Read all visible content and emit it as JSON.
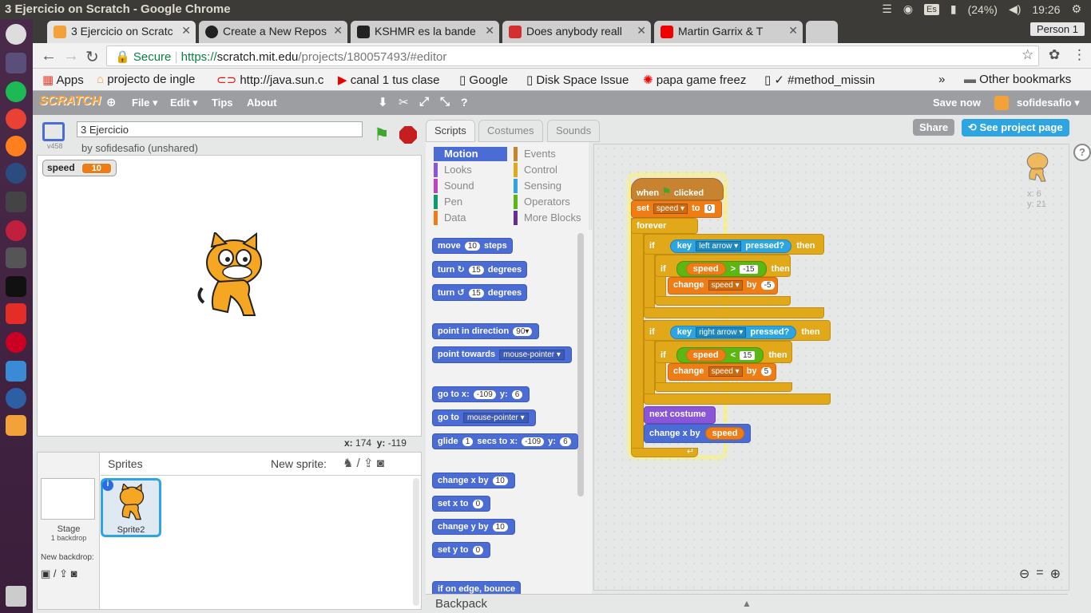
{
  "window_title": "3 Ejercicio on Scratch - Google Chrome",
  "system": {
    "lang": "Es",
    "battery": "(24%)",
    "time": "19:26"
  },
  "tabs": [
    {
      "label": "3 Ejercicio on Scratc",
      "icon_color": "#f3a23a"
    },
    {
      "label": "Create a New Repos",
      "icon_color": "#222"
    },
    {
      "label": "KSHMR es la bande",
      "icon_color": "#222"
    },
    {
      "label": "Does anybody reall",
      "icon_color": "#d32f2f"
    },
    {
      "label": "Martin Garrix & T",
      "icon_color": "#e00"
    }
  ],
  "person": "Person 1",
  "url": {
    "secure": "Secure",
    "scheme": "https://",
    "host": "scratch.mit.edu",
    "path": "/projects/180057493/#editor"
  },
  "bookmarks": [
    "Apps",
    "projecto de ingle",
    "http://java.sun.c",
    "canal 1 tus clase",
    "Google",
    "Disk Space Issue",
    "papa game freez",
    "#method_missin"
  ],
  "other_bookmarks": "Other bookmarks",
  "scratch_menu": {
    "file": "File",
    "edit": "Edit",
    "tips": "Tips",
    "about": "About",
    "save": "Save now",
    "user": "sofidesafio",
    "logo": "SCRATCH"
  },
  "project": {
    "title": "3 Ejercicio",
    "byline": "by sofidesafio (unshared)",
    "version": "v458"
  },
  "monitor": {
    "label": "speed",
    "value": "10"
  },
  "stage_coords": {
    "x_label": "x:",
    "x": "174",
    "y_label": "y:",
    "y": "-119"
  },
  "sprites": {
    "heading": "Sprites",
    "new_sprite": "New sprite:",
    "stage_label": "Stage",
    "stage_sub": "1 backdrop",
    "new_backdrop": "New backdrop:",
    "sprite_name": "Sprite2"
  },
  "palette_tabs": [
    "Scripts",
    "Costumes",
    "Sounds"
  ],
  "buttons": {
    "share": "Share",
    "see_project": "See project page"
  },
  "categories": [
    {
      "label": "Motion",
      "color": "#4a6cd4"
    },
    {
      "label": "Events",
      "color": "#c88330"
    },
    {
      "label": "Looks",
      "color": "#8a55d7"
    },
    {
      "label": "Control",
      "color": "#e1a91a"
    },
    {
      "label": "Sound",
      "color": "#bb42c3"
    },
    {
      "label": "Sensing",
      "color": "#2ca5e2"
    },
    {
      "label": "Pen",
      "color": "#0e9a6c"
    },
    {
      "label": "Operators",
      "color": "#5cb712"
    },
    {
      "label": "Data",
      "color": "#ee7d16"
    },
    {
      "label": "More Blocks",
      "color": "#632d99"
    }
  ],
  "palette_blocks": {
    "move": "move",
    "move_n": "10",
    "steps": "steps",
    "turn": "turn",
    "turn_n": "15",
    "degrees": "degrees",
    "point_dir": "point in direction",
    "dir_v": "90▾",
    "point_towards": "point towards",
    "mouse_pointer": "mouse-pointer",
    "goto_xy": "go to x:",
    "gx": "-109",
    "y": "y:",
    "gy": "6",
    "goto": "go to",
    "glide": "glide",
    "gl_n": "1",
    "secs_to_x": "secs to x:",
    "change_x": "change x by",
    "cx": "10",
    "set_x": "set x to",
    "sx": "0",
    "change_y": "change y by",
    "cy": "10",
    "set_y": "set y to",
    "sy": "0",
    "bounce": "if on edge, bounce"
  },
  "backpack": "Backpack",
  "sprite_info": {
    "x": "x: 6",
    "y": "y: 21"
  },
  "script": {
    "when": "when",
    "clicked": "clicked",
    "set": "set",
    "speed_var": "speed",
    "to": "to",
    "set_v": "0",
    "forever": "forever",
    "if": "if",
    "key": "key",
    "left_arrow": "left arrow",
    "pressed": "pressed?",
    "then": "then",
    "speed": "speed",
    "gt": ">",
    "gt_v": "-15",
    "change": "change",
    "by": "by",
    "by_neg": "-5",
    "right_arrow": "right arrow",
    "lt": "<",
    "lt_v": "15",
    "by_pos": "5",
    "next_costume": "next costume",
    "change_x": "change x by"
  }
}
